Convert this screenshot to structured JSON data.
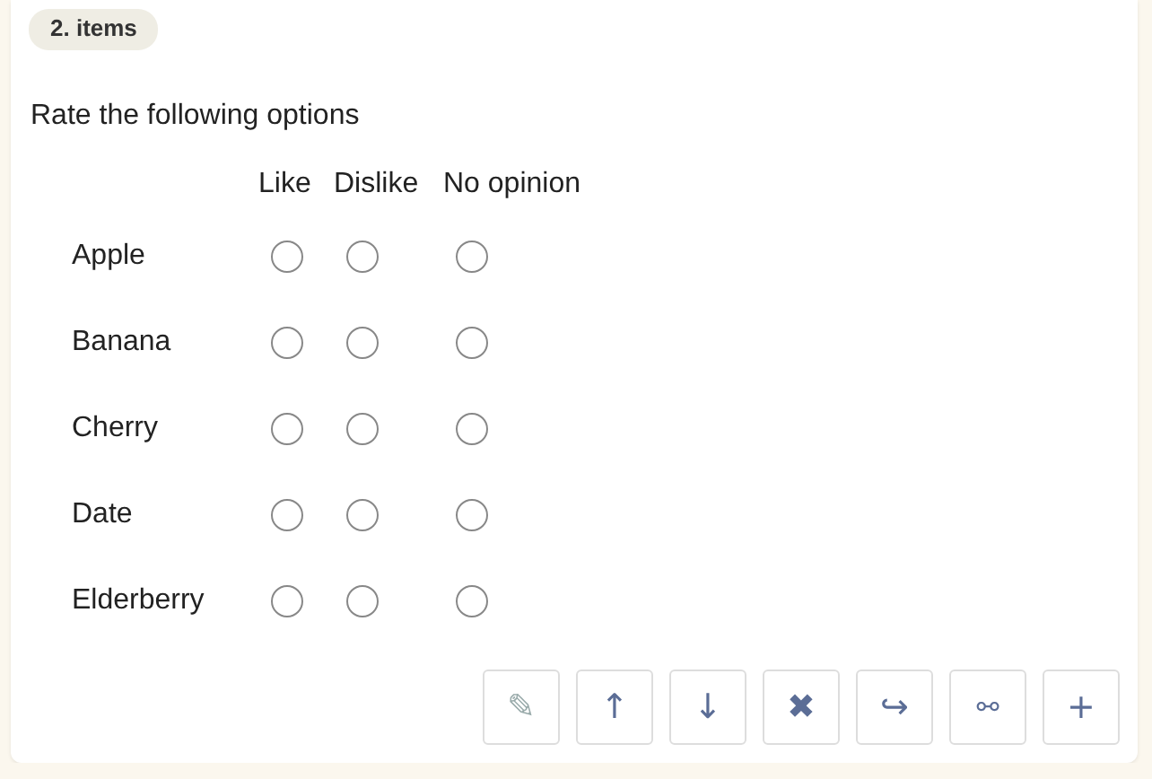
{
  "badge": "2. items",
  "question": "Rate the following options",
  "columns": [
    "Like",
    "Dislike",
    "No opinion"
  ],
  "rows": [
    {
      "label": "Apple",
      "choices": [
        {
          "selected": false
        },
        {
          "selected": false
        },
        {
          "selected": false
        }
      ]
    },
    {
      "label": "Banana",
      "choices": [
        {
          "selected": false
        },
        {
          "selected": false
        },
        {
          "selected": false
        }
      ]
    },
    {
      "label": "Cherry",
      "choices": [
        {
          "selected": false
        },
        {
          "selected": false
        },
        {
          "selected": false
        }
      ]
    },
    {
      "label": "Date",
      "choices": [
        {
          "selected": false
        },
        {
          "selected": false
        },
        {
          "selected": false
        }
      ]
    },
    {
      "label": "Elderberry",
      "choices": [
        {
          "selected": false
        },
        {
          "selected": false
        },
        {
          "selected": false
        }
      ]
    }
  ],
  "toolbar": [
    {
      "kind": "edit",
      "glyph": "✎"
    },
    {
      "kind": "up",
      "glyph": "↑"
    },
    {
      "kind": "down",
      "glyph": "↓"
    },
    {
      "kind": "delete",
      "glyph": "✖"
    },
    {
      "kind": "move",
      "glyph": "↪"
    },
    {
      "kind": "link",
      "glyph": "⚯"
    },
    {
      "kind": "add",
      "glyph": "+"
    }
  ]
}
